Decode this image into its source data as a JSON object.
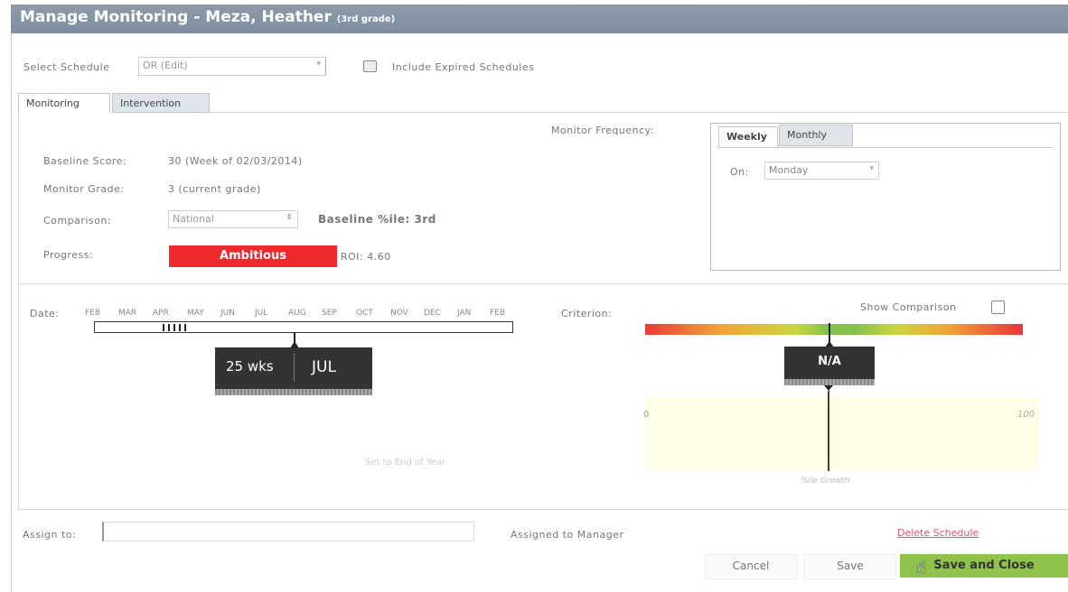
{
  "title": {
    "main": "Manage Monitoring - Meza, Heather",
    "grade": "(3rd grade)"
  },
  "schedule": {
    "label": "Select Schedule",
    "value": "OR (Edit)",
    "include_expired_label": "Include Expired Schedules"
  },
  "tabs": [
    {
      "label": "Monitoring",
      "active": true
    },
    {
      "label": "Intervention",
      "active": false
    }
  ],
  "monitoring": {
    "baseline_score_label": "Baseline Score:",
    "baseline_score_value": "30 (Week of 02/03/2014)",
    "monitor_grade_label": "Monitor Grade:",
    "monitor_grade_value": "3 (current grade)",
    "comparison_label": "Comparison:",
    "comparison_value": "National",
    "baseline_pile": "Baseline %ile: 3rd",
    "progress_label": "Progress:",
    "progress_value": "Ambitious",
    "roi": "ROI: 4.60"
  },
  "frequency": {
    "label": "Monitor Frequency:",
    "tabs": [
      {
        "label": "Weekly",
        "active": true
      },
      {
        "label": "Monthly",
        "active": false
      }
    ],
    "on_label": "On:",
    "day": "Monday"
  },
  "timeline": {
    "date_label": "Date:",
    "months": [
      "FEB",
      "MAR",
      "APR",
      "MAY",
      "JUN",
      "JUL",
      "AUG",
      "SEP",
      "OCT",
      "NOV",
      "DEC",
      "JAN",
      "FEB"
    ],
    "weeks_label": "25 wks",
    "month_label": "JUL",
    "set_end_link": "Set to End of Year"
  },
  "criterion": {
    "label": "Criterion:",
    "show_comparison": "Show Comparison",
    "value": "N/A",
    "axis_min": "0",
    "axis_max": "100",
    "footer": "%ile Growth"
  },
  "footer": {
    "assign_label": "Assign to:",
    "assigned_manager": "Assigned to Manager",
    "delete_link": "Delete Schedule",
    "cancel": "Cancel",
    "save": "Save",
    "save_close": "Save and Close"
  },
  "colors": {
    "titlebar": "#8292a4",
    "progress_red": "#ee2a2f",
    "save_close_green": "#8fc24a",
    "delete_red": "#e0556a"
  }
}
